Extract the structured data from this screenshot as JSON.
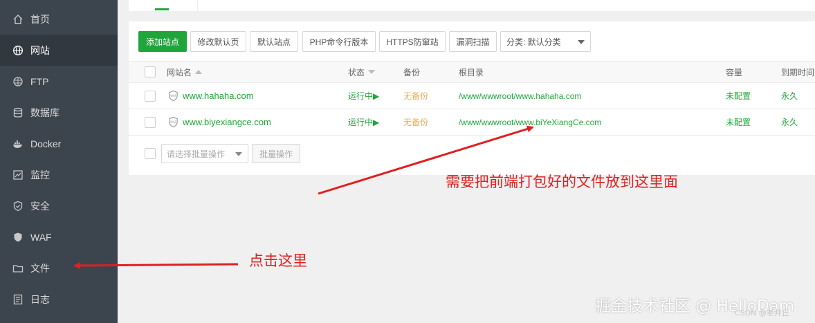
{
  "sidebar": {
    "items": [
      {
        "label": "首页",
        "icon": "home-icon",
        "active": false
      },
      {
        "label": "网站",
        "icon": "globe-icon",
        "active": true
      },
      {
        "label": "FTP",
        "icon": "ftp-icon",
        "active": false
      },
      {
        "label": "数据库",
        "icon": "database-icon",
        "active": false
      },
      {
        "label": "Docker",
        "icon": "docker-icon",
        "active": false
      },
      {
        "label": "监控",
        "icon": "monitor-icon",
        "active": false
      },
      {
        "label": "安全",
        "icon": "shield-check-icon",
        "active": false
      },
      {
        "label": "WAF",
        "icon": "waf-shield-icon",
        "active": false
      },
      {
        "label": "文件",
        "icon": "folder-icon",
        "active": false
      },
      {
        "label": "日志",
        "icon": "log-icon",
        "active": false
      }
    ]
  },
  "toolbar": {
    "add_site": "添加站点",
    "edit_default_page": "修改默认页",
    "default_site": "默认站点",
    "php_cli_version": "PHP命令行版本",
    "https_protect": "HTTPS防窜站",
    "vuln_scan": "漏洞扫描",
    "category_select": "分类: 默认分类"
  },
  "table": {
    "headers": {
      "site_name": "网站名",
      "status": "状态",
      "backup": "备份",
      "root_dir": "根目录",
      "capacity": "容量",
      "expire": "到期时间"
    },
    "rows": [
      {
        "site_name": "www.hahaha.com",
        "status": "运行中▶",
        "backup": "无备份",
        "root_dir": "/www/wwwroot/www.hahaha.com",
        "capacity": "未配置",
        "expire": "永久"
      },
      {
        "site_name": "www.biyexiangce.com",
        "status": "运行中▶",
        "backup": "无备份",
        "root_dir": "/www/wwwroot/www.biYeXiangCe.com",
        "capacity": "未配置",
        "expire": "永久"
      }
    ]
  },
  "bottom_bar": {
    "batch_select_placeholder": "请选择批量操作",
    "batch_button": "批量操作"
  },
  "annotations": {
    "files_hint": "点击这里",
    "root_hint": "需要把前端打包好的文件放到这里面",
    "color": "#e02020"
  },
  "watermark": {
    "main": "掘金技术社区 @ HelloDam",
    "csdn": "CSDN @老井丘"
  },
  "colors": {
    "sidebar_bg": "#3c444d",
    "accent_green": "#20a53a",
    "warning_orange": "#f0ad4e"
  }
}
